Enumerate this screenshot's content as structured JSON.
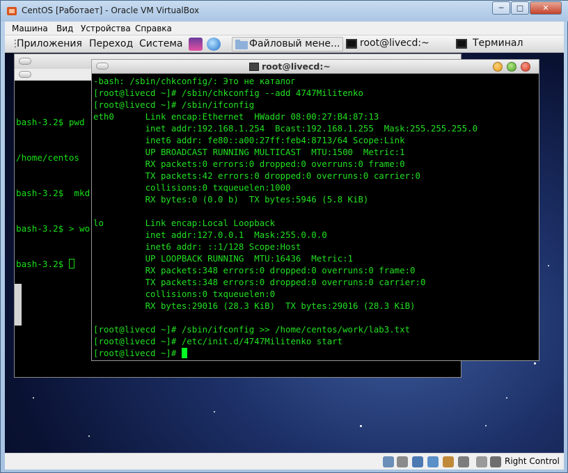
{
  "window": {
    "title": "CentOS [Работает] - Oracle VM VirtualBox",
    "close_glyph": "✕",
    "min_glyph": "─",
    "max_glyph": "□"
  },
  "vbox_menu": [
    "Машина",
    "Вид",
    "Устройства",
    "Справка"
  ],
  "gnome_panel": {
    "applications": "Приложения",
    "places": "Переход",
    "system": "Система",
    "task_files": "Файловый мене...",
    "task_root": "root@livecd:~",
    "task_terminal": "Терминал"
  },
  "back_terminal": {
    "lines": [
      "bash-3.2$ pwd",
      "/home/centos",
      "bash-3.2$  mkd",
      "bash-3.2$ > wo",
      "bash-3.2$ "
    ]
  },
  "front_terminal": {
    "title": "root@livecd:~",
    "lines": [
      "-bash: /sbin/chkconfig/: Это не каталог",
      "[root@livecd ~]# /sbin/chkconfig --add 4747Militenko",
      "[root@livecd ~]# /sbin/ifconfig",
      "eth0      Link encap:Ethernet  HWaddr 08:00:27:B4:87:13",
      "          inet addr:192.168.1.254  Bcast:192.168.1.255  Mask:255.255.255.0",
      "          inet6 addr: fe80::a00:27ff:feb4:8713/64 Scope:Link",
      "          UP BROADCAST RUNNING MULTICAST  MTU:1500  Metric:1",
      "          RX packets:0 errors:0 dropped:0 overruns:0 frame:0",
      "          TX packets:42 errors:0 dropped:0 overruns:0 carrier:0",
      "          collisions:0 txqueuelen:1000",
      "          RX bytes:0 (0.0 b)  TX bytes:5946 (5.8 KiB)",
      "",
      "lo        Link encap:Local Loopback",
      "          inet addr:127.0.0.1  Mask:255.0.0.0",
      "          inet6 addr: ::1/128 Scope:Host",
      "          UP LOOPBACK RUNNING  MTU:16436  Metric:1",
      "          RX packets:348 errors:0 dropped:0 overruns:0 frame:0",
      "          TX packets:348 errors:0 dropped:0 overruns:0 carrier:0",
      "          collisions:0 txqueuelen:0",
      "          RX bytes:29016 (28.3 KiB)  TX bytes:29016 (28.3 KiB)",
      "",
      "[root@livecd ~]# /sbin/ifconfig >> /home/centos/work/lab3.txt",
      "[root@livecd ~]# /etc/init.d/4747Militenko start",
      "[root@livecd ~]# "
    ]
  },
  "statusbar": {
    "host_key": "Right Control",
    "icons": [
      "hdd-icon",
      "cd-icon",
      "usb-icon",
      "network-icon",
      "shared-folders-icon",
      "display-icon",
      "capture-icon",
      "mouse-integration-icon",
      "host-key-icon"
    ]
  },
  "colors": {
    "terminal_fg": "#22e022",
    "terminal_bg": "#000000",
    "cursor": "#00ff22"
  }
}
